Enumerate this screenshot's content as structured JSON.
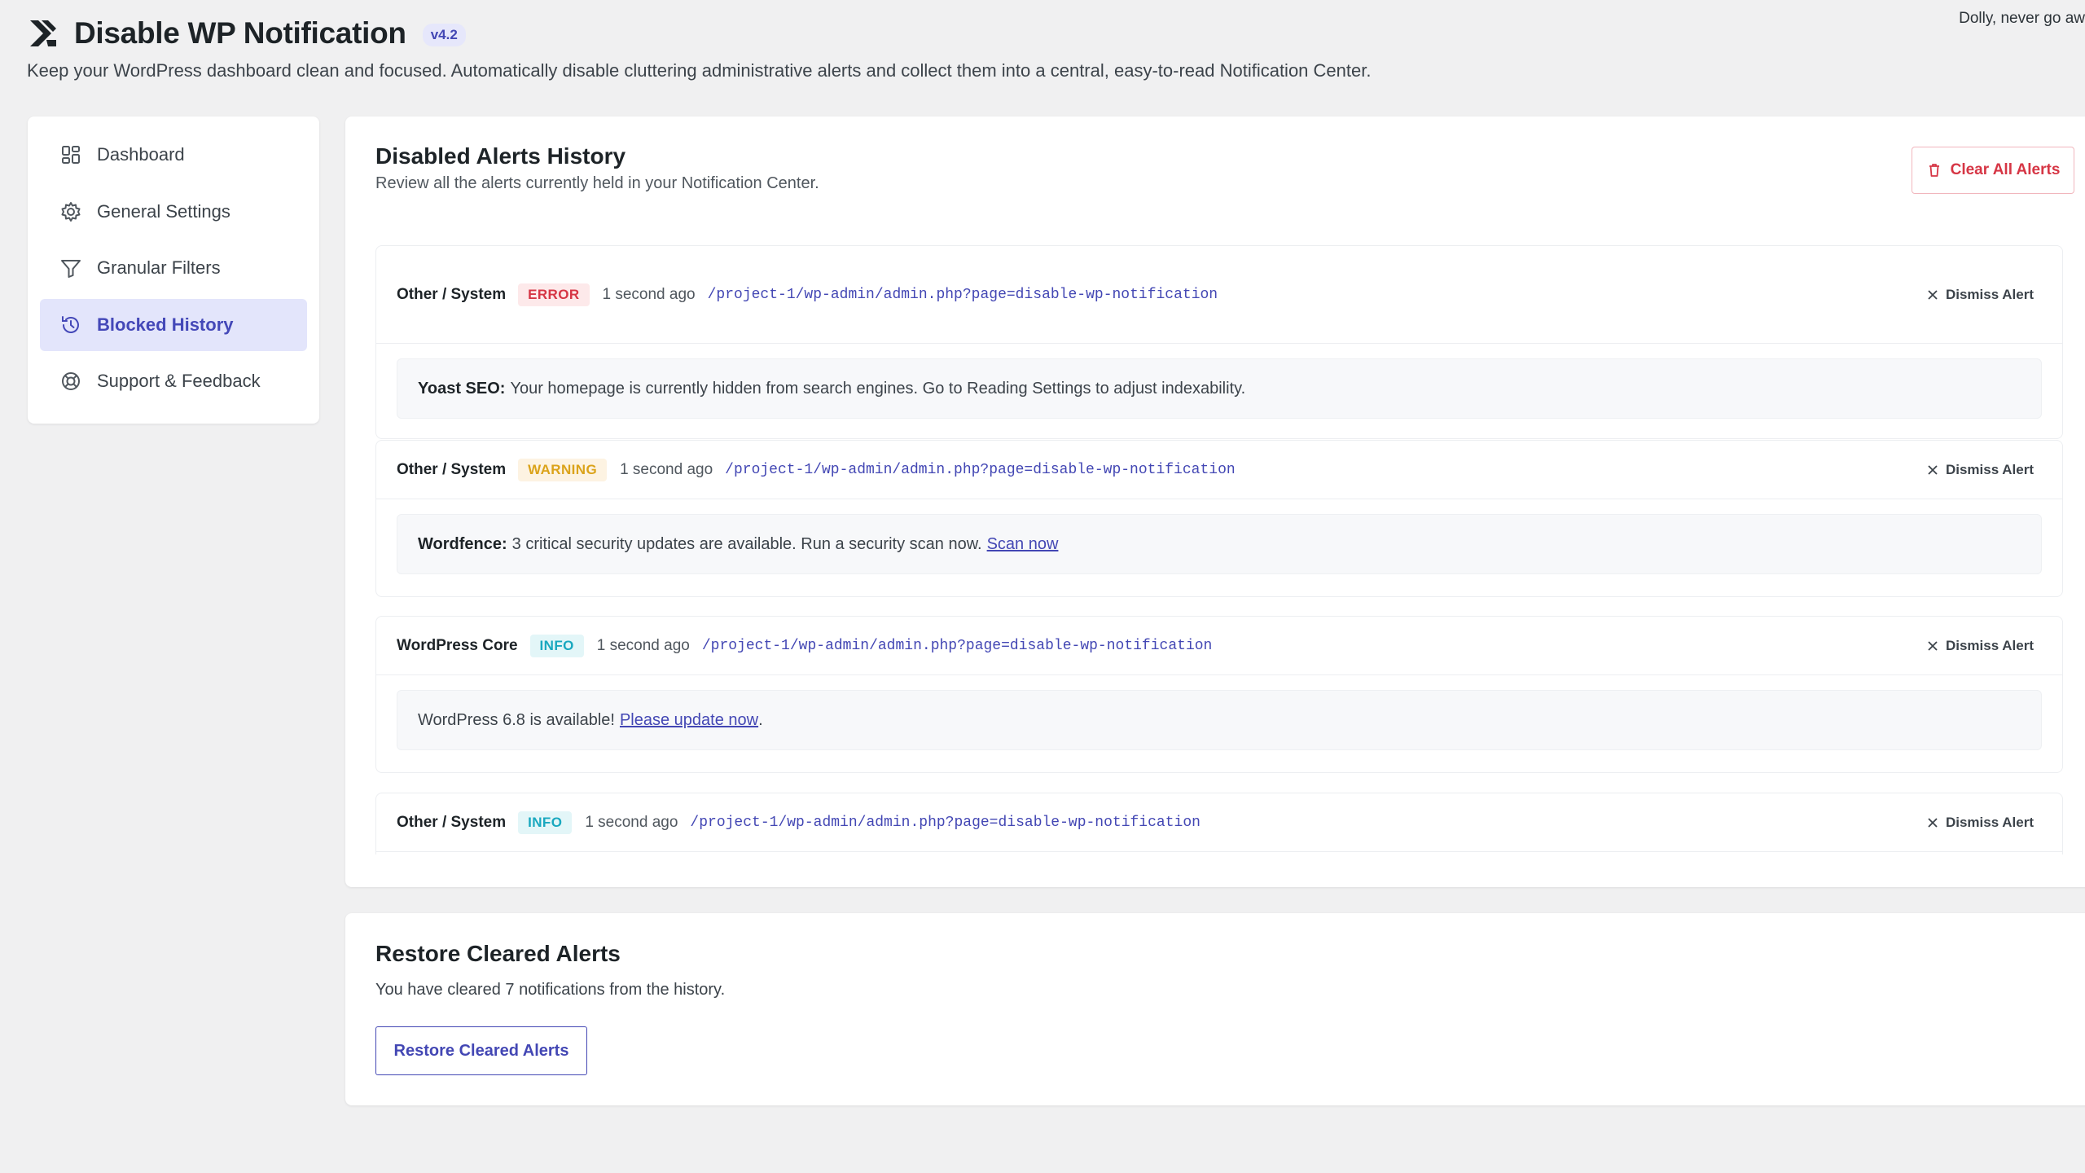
{
  "top_bar": {
    "dolly_text": "Dolly, never go aw"
  },
  "header": {
    "title": "Disable WP Notification",
    "version": "v4.2",
    "tagline": "Keep your WordPress dashboard clean and focused. Automatically disable cluttering administrative alerts and collect them into a central, easy-to-read Notification Center."
  },
  "sidebar": {
    "items": [
      {
        "label": "Dashboard",
        "icon": "dashboard-icon"
      },
      {
        "label": "General Settings",
        "icon": "gear-icon"
      },
      {
        "label": "Granular Filters",
        "icon": "filter-icon"
      },
      {
        "label": "Blocked History",
        "icon": "history-icon",
        "active": true
      },
      {
        "label": "Support & Feedback",
        "icon": "lifebuoy-icon"
      }
    ]
  },
  "history": {
    "title": "Disabled Alerts History",
    "subtitle": "Review all the alerts currently held in your Notification Center.",
    "clear_label": "Clear All Alerts",
    "dismiss_label": "Dismiss Alert",
    "alerts": [
      {
        "source": "Other / System",
        "severity": "ERROR",
        "time": "1 second ago",
        "url": "/project-1/wp-admin/admin.php?page=disable-wp-notification",
        "message_bold": "Yoast SEO:",
        "message": "Your homepage is currently hidden from search engines. Go to Reading Settings to adjust indexability.",
        "link": "",
        "suffix": ""
      },
      {
        "source": "Other / System",
        "severity": "WARNING",
        "time": "1 second ago",
        "url": "/project-1/wp-admin/admin.php?page=disable-wp-notification",
        "message_bold": "Wordfence:",
        "message": "3 critical security updates are available. Run a security scan now.",
        "link": "Scan now",
        "suffix": ""
      },
      {
        "source": "WordPress Core",
        "severity": "INFO",
        "time": "1 second ago",
        "url": "/project-1/wp-admin/admin.php?page=disable-wp-notification",
        "message_bold": "",
        "message": "WordPress 6.8 is available!",
        "link": "Please update now",
        "suffix": "."
      },
      {
        "source": "Other / System",
        "severity": "INFO",
        "time": "1 second ago",
        "url": "/project-1/wp-admin/admin.php?page=disable-wp-notification"
      }
    ]
  },
  "restore": {
    "title": "Restore Cleared Alerts",
    "description": "You have cleared 7 notifications from the history.",
    "button_label": "Restore Cleared Alerts"
  },
  "colors": {
    "accent": "#4347b4",
    "error": "#d63645",
    "warning": "#dba31a",
    "info": "#19a8bf",
    "background": "#f0f0f1"
  }
}
